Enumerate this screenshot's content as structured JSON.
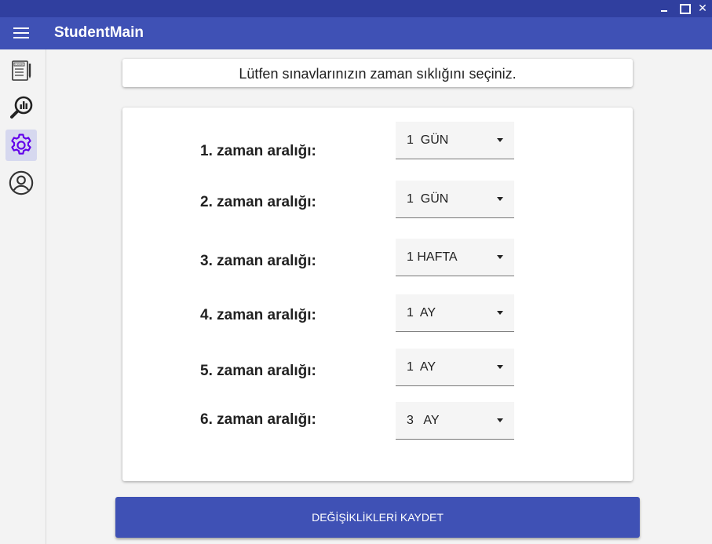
{
  "window": {
    "minimize_label": "",
    "maximize_label": "",
    "close_label": "✕"
  },
  "appbar": {
    "title": "StudentMain"
  },
  "sidebar": {
    "items": [
      {
        "name": "exam",
        "icon": "exam-icon",
        "active": false
      },
      {
        "name": "statistics",
        "icon": "chart-search-icon",
        "active": false
      },
      {
        "name": "settings",
        "icon": "gear-icon",
        "active": true
      },
      {
        "name": "profile",
        "icon": "user-icon",
        "active": false
      }
    ]
  },
  "header": {
    "title": "Lütfen sınavlarınızın zaman sıklığını seçiniz."
  },
  "intervals": [
    {
      "label": "1. zaman aralığı:",
      "value": "1  GÜN"
    },
    {
      "label": "2. zaman aralığı:",
      "value": "1  GÜN"
    },
    {
      "label": "3. zaman aralığı:",
      "value": "1 HAFTA"
    },
    {
      "label": "4. zaman aralığı:",
      "value": "1  AY"
    },
    {
      "label": "5. zaman aralığı:",
      "value": "1  AY"
    },
    {
      "label": "6. zaman aralığı:",
      "value": "3   AY"
    }
  ],
  "save_button": {
    "label": "DEĞİŞİKLİKLERİ KAYDET"
  },
  "colors": {
    "primary": "#3f51b5",
    "titlebar": "#303f9f",
    "accent": "#6200ea"
  }
}
